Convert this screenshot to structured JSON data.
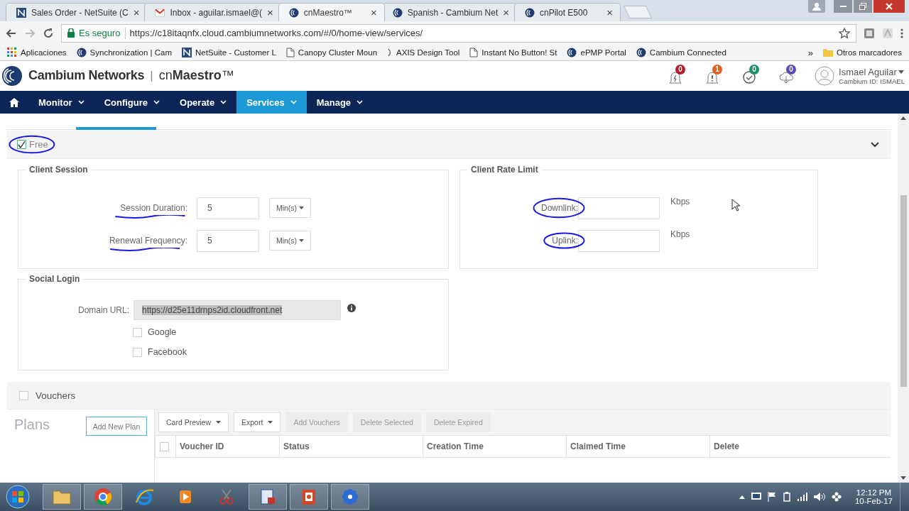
{
  "browser": {
    "tabs": [
      {
        "title": "Sales Order - NetSuite (C",
        "kind": "netsuite",
        "close": "×",
        "selected": false
      },
      {
        "title": "Inbox - aguilar.ismael@(",
        "kind": "mail",
        "close": "×",
        "selected": false
      },
      {
        "title": "cnMaestro™",
        "kind": "cambium",
        "close": "×",
        "selected": true
      },
      {
        "title": "Spanish - Cambium Net",
        "kind": "cambium",
        "close": "×",
        "selected": false
      },
      {
        "title": "cnPilot E500",
        "kind": "cambium",
        "close": "×",
        "selected": false
      }
    ],
    "security": "Es seguro",
    "url": "https://c18itaqnfx.cloud.cambiumnetworks.com/#/0/home-view/services/",
    "bookmarks": [
      {
        "label": "Aplicaciones",
        "kind": "apps"
      },
      {
        "label": "Synchronization | Cam",
        "kind": "cambium"
      },
      {
        "label": "NetSuite - Customer L",
        "kind": "netsuite"
      },
      {
        "label": "Canopy Cluster Moun",
        "kind": "page"
      },
      {
        "label": "AXIS Design Tool",
        "kind": "axis"
      },
      {
        "label": "Instant No Button! St",
        "kind": "page"
      },
      {
        "label": "ePMP Portal",
        "kind": "cambium"
      },
      {
        "label": "Cambium Connected",
        "kind": "cambium"
      }
    ],
    "more": "»",
    "other_bookmarks": "Otros marcadores"
  },
  "app": {
    "brand": "Cambium Networks",
    "separator": "|",
    "product": "cn**Maestro**™",
    "notifications": [
      {
        "kind": "alarm",
        "count": "0",
        "color": "#b0202a"
      },
      {
        "kind": "alert",
        "count": "1",
        "color": "#e0621c"
      },
      {
        "kind": "task",
        "count": "0",
        "color": "#1e8e64"
      },
      {
        "kind": "update",
        "count": "0",
        "color": "#5a4cb5"
      }
    ],
    "user": {
      "name": "Ismael Aguilar",
      "id": "Cambium ID: ISMAEL"
    }
  },
  "nav": [
    {
      "label": "Monitor",
      "selected": false
    },
    {
      "label": "Configure",
      "selected": false
    },
    {
      "label": "Operate",
      "selected": false
    },
    {
      "label": "Services",
      "selected": true
    },
    {
      "label": "Manage",
      "selected": false
    }
  ],
  "free": {
    "label": "Free",
    "checked": true,
    "kind": "circled"
  },
  "client_session": {
    "title": "Client Session",
    "fields": [
      {
        "label": "Session Duration:",
        "value": "5",
        "unit": "Min(s)",
        "kind": "underlined"
      },
      {
        "label": "Renewal Frequency:",
        "value": "5",
        "unit": "Min(s)",
        "kind": "underlined"
      }
    ]
  },
  "client_rate_limit": {
    "title": "Client Rate Limit",
    "fields": [
      {
        "label": "Downlink:",
        "unit": "Kbps",
        "kind": "circled"
      },
      {
        "label": "Uplink:",
        "unit": "Kbps",
        "kind": "circled"
      }
    ]
  },
  "social_login": {
    "title": "Social Login",
    "domain_label": "Domain URL:",
    "domain_url": "https://d25e11drnps2id.cloudfront.net",
    "options": [
      {
        "label": "Google",
        "checked": false
      },
      {
        "label": "Facebook",
        "checked": false
      }
    ]
  },
  "vouchers": {
    "label": "Vouchers",
    "checked": false,
    "plans_title": "Plans",
    "add_plan": "Add New Plan",
    "toolbar": [
      {
        "label": "Card Preview",
        "dropdown": true,
        "disabled": false
      },
      {
        "label": "Export",
        "dropdown": true,
        "disabled": false
      },
      {
        "label": "Add Vouchers",
        "dropdown": false,
        "disabled": true
      },
      {
        "label": "Delete Selected",
        "dropdown": false,
        "disabled": true
      },
      {
        "label": "Delete Expired",
        "dropdown": false,
        "disabled": true
      }
    ],
    "select_all_checked": false,
    "columns": [
      "Voucher ID",
      "Status",
      "Creation Time",
      "Claimed Time",
      "Delete"
    ]
  },
  "taskbar": {
    "apps": [
      {
        "kind": "folder",
        "running": true
      },
      {
        "kind": "chrome",
        "running": true
      },
      {
        "kind": "ie",
        "running": false
      },
      {
        "kind": "media",
        "running": false
      },
      {
        "kind": "scissors",
        "running": false
      },
      {
        "kind": "lync",
        "running": true
      },
      {
        "kind": "powerpoint",
        "running": true
      },
      {
        "kind": "flower",
        "running": true
      }
    ],
    "time": "12:12 PM",
    "date": "10-Feb-17"
  }
}
